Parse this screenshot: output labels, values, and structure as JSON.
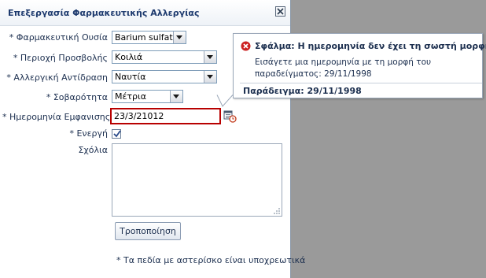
{
  "dialog": {
    "title": "Επεξεργασία Φαρμακευτικής Αλλεργίας"
  },
  "form": {
    "substance": {
      "label": "* Φαρμακευτική Ουσία",
      "value": "Barium sulfate"
    },
    "area": {
      "label": "* Περιοχή Προσβολής",
      "value": "Κοιλιά"
    },
    "reaction": {
      "label": "* Αλλεργική Αντίδραση",
      "value": "Ναυτία"
    },
    "severity": {
      "label": "* Σοβαρότητα",
      "value": "Μέτρια"
    },
    "onset_date": {
      "label": "* Ημερομηνία Εμφανισης",
      "value": "23/3/21012"
    },
    "active": {
      "label": "* Ενεργή",
      "checked": true
    },
    "comments": {
      "label": "Σχόλια",
      "value": ""
    }
  },
  "actions": {
    "modify_label": "Τροποποίηση"
  },
  "footnote": "* Τα πεδία με αστερίσκο είναι υποχρεωτικά",
  "error_popup": {
    "title": "Σφάλμα: Η ημερομηνία δεν έχει τη σωστή μορφή.",
    "message": "Εισάγετε μια ημερομηνία με τη μορφή του παραδείγματος: 29/11/1998",
    "example": "Παράδειγμα: 29/11/1998"
  },
  "colors": {
    "error_border": "#b80000",
    "error_icon": "#cc2222",
    "text": "#1c2f4f"
  }
}
